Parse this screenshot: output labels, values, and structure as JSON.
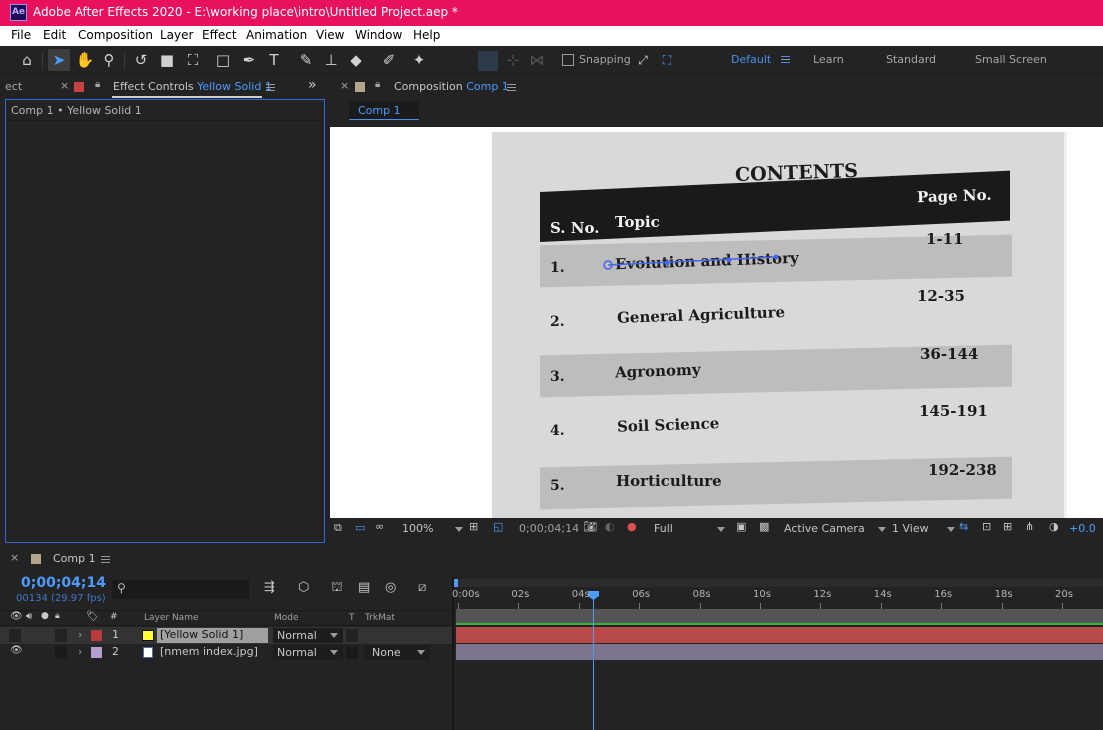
{
  "window": {
    "title": "Adobe After Effects 2020 - E:\\working place\\intro\\Untitled Project.aep *",
    "app_icon": "Ae",
    "accent_color": "#e8115e"
  },
  "menu": [
    "File",
    "Edit",
    "Composition",
    "Layer",
    "Effect",
    "Animation",
    "View",
    "Window",
    "Help"
  ],
  "toolbar": {
    "tools": [
      "home-icon",
      "selection-icon",
      "hand-icon",
      "zoom-icon",
      "rotate-icon",
      "camera-orbit-icon",
      "rectangle-icon",
      "pen-icon",
      "type-icon",
      "brush-icon",
      "clone-stamp-icon",
      "eraser-icon",
      "roto-brush-icon",
      "puppet-pin-icon"
    ],
    "snapping_label": "Snapping",
    "workspaces": [
      "Default",
      "Learn",
      "Standard",
      "Small Screen"
    ],
    "active_workspace": "Default"
  },
  "effect_panel": {
    "left_tab_label": "ect",
    "tab_label": "Effect Controls",
    "tab_layer": "Yellow Solid 1",
    "subheader": "Comp 1 • Yellow Solid 1",
    "expand_label": "»"
  },
  "comp_panel": {
    "tab_label": "Composition",
    "tab_comp": "Comp 1",
    "breadcrumb": "Comp 1"
  },
  "viewer_image": {
    "heading": "CONTENTS",
    "col_sno": "S. No.",
    "col_topic": "Topic",
    "col_page": "Page No.",
    "rows": [
      {
        "no": "1.",
        "topic": "Evolution and History",
        "pages": "1-11"
      },
      {
        "no": "2.",
        "topic": "General Agriculture",
        "pages": "12-35"
      },
      {
        "no": "3.",
        "topic": "Agronomy",
        "pages": "36-144"
      },
      {
        "no": "4.",
        "topic": "Soil Science",
        "pages": "145-191"
      },
      {
        "no": "5.",
        "topic": "Horticulture",
        "pages": "192-238"
      }
    ]
  },
  "viewer_footer": {
    "zoom": "100%",
    "timecode": "0;00;04;14",
    "resolution": "Full",
    "camera": "Active Camera",
    "views": "1 View",
    "exposure": "+0.0"
  },
  "timeline": {
    "tab_label": "Comp 1",
    "current_time": "0;00;04;14",
    "frame_info": "00134 (29.97 fps)",
    "search_placeholder": "",
    "columns": {
      "num": "#",
      "layer_name": "Layer Name",
      "mode": "Mode",
      "t": "T",
      "trkmat": "TrkMat"
    },
    "ruler": [
      "0:00s",
      "02s",
      "04s",
      "06s",
      "08s",
      "10s",
      "12s",
      "14s",
      "16s",
      "18s",
      "20s"
    ],
    "playhead_seconds": 4.47,
    "layers": [
      {
        "num": "1",
        "name": "[Yellow Solid 1]",
        "mode": "Normal",
        "trkmat": "",
        "label_color": "#b83a3a",
        "swatch": "#ffff33",
        "bar_color": "#b84a4a"
      },
      {
        "num": "2",
        "name": "[nmem index.jpg]",
        "mode": "Normal",
        "trkmat": "None",
        "label_color": "#b4a0d0",
        "swatch": "#ffffff",
        "bar_color": "#7d7590"
      }
    ]
  }
}
